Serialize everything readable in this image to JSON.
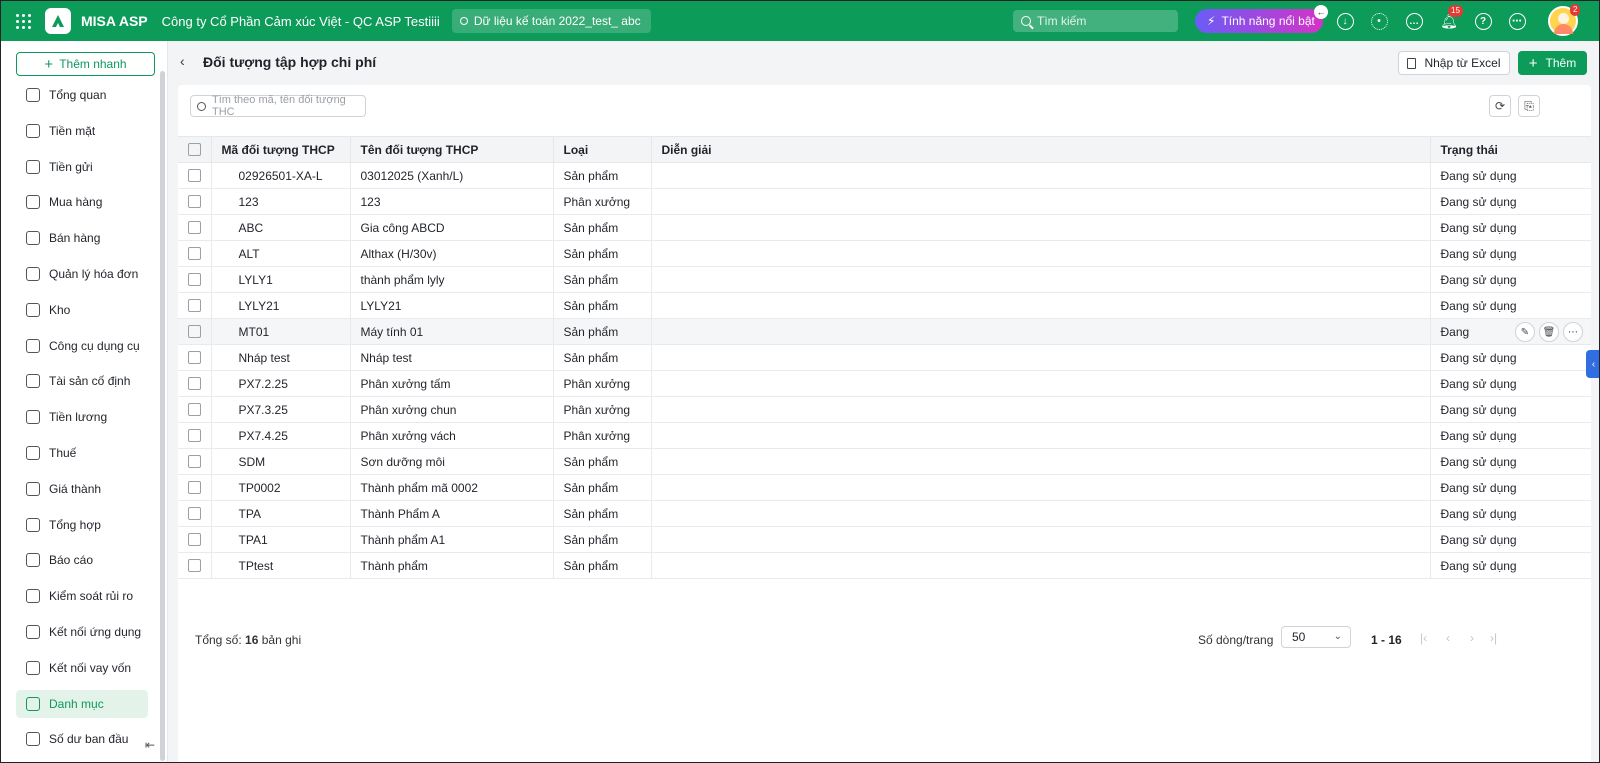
{
  "topbar": {
    "app_name": "MISA ASP",
    "company": "Công ty Cổ Phần Cảm xúc Việt - QC ASP Testiiii",
    "dataset": "Dữ liệu kế toán 2022_test_ abc",
    "search_placeholder": "Tìm kiếm",
    "feature_label": "Tính năng nổi bật",
    "notification_count": "15",
    "avatar_badge": "2"
  },
  "sidebar": {
    "quick_add": "Thêm nhanh",
    "items": [
      {
        "label": "Tổng quan",
        "icon": "dashboard-icon"
      },
      {
        "label": "Tiền mặt",
        "icon": "cash-icon"
      },
      {
        "label": "Tiền gửi",
        "icon": "bank-icon"
      },
      {
        "label": "Mua hàng",
        "icon": "shopping-bag-icon"
      },
      {
        "label": "Bán hàng",
        "icon": "cart-icon"
      },
      {
        "label": "Quản lý hóa đơn",
        "icon": "invoice-icon"
      },
      {
        "label": "Kho",
        "icon": "warehouse-icon"
      },
      {
        "label": "Công cụ dụng cụ",
        "icon": "tools-icon"
      },
      {
        "label": "Tài sản cố định",
        "icon": "truck-icon"
      },
      {
        "label": "Tiền lương",
        "icon": "salary-icon"
      },
      {
        "label": "Thuế",
        "icon": "tax-icon"
      },
      {
        "label": "Giá thành",
        "icon": "price-icon"
      },
      {
        "label": "Tổng hợp",
        "icon": "summary-icon"
      },
      {
        "label": "Báo cáo",
        "icon": "report-icon"
      },
      {
        "label": "Kiểm soát rủi ro",
        "icon": "risk-icon"
      },
      {
        "label": "Kết nối ứng dụng",
        "icon": "plug-icon"
      },
      {
        "label": "Kết nối vay vốn",
        "icon": "loan-icon"
      },
      {
        "label": "Danh mục",
        "icon": "list-icon"
      },
      {
        "label": "Số dư ban đầu",
        "icon": "balance-icon"
      }
    ],
    "active_index": 17
  },
  "page": {
    "title": "Đối tượng tập hợp chi phí",
    "import_excel": "Nhập từ Excel",
    "add": "Thêm",
    "search_placeholder": "Tìm theo mã, tên đối tượng THC"
  },
  "table": {
    "columns": [
      "Mã đối tượng THCP",
      "Tên đối tượng THCP",
      "Loại",
      "Diễn giải",
      "Trạng thái"
    ],
    "rows": [
      {
        "code": "02926501-XA-L",
        "name": "03012025 (Xanh/L)",
        "type": "Sản phẩm",
        "desc": "",
        "status": "Đang sử dụng"
      },
      {
        "code": "123",
        "name": "123",
        "type": "Phân xưởng",
        "desc": "",
        "status": "Đang sử dụng"
      },
      {
        "code": "ABC",
        "name": "Gia công ABCD",
        "type": "Sản phẩm",
        "desc": "",
        "status": "Đang sử dụng"
      },
      {
        "code": "ALT",
        "name": "Althax (H/30v)",
        "type": "Sản phẩm",
        "desc": "",
        "status": "Đang sử dụng"
      },
      {
        "code": "LYLY1",
        "name": "thành phẩm lyly",
        "type": "Sản phẩm",
        "desc": "",
        "status": "Đang sử dụng"
      },
      {
        "code": "LYLY21",
        "name": "LYLY21",
        "type": "Sản phẩm",
        "desc": "",
        "status": "Đang sử dụng"
      },
      {
        "code": "MT01",
        "name": "Máy tính 01",
        "type": "Sản phẩm",
        "desc": "",
        "status": "Đang"
      },
      {
        "code": "Nháp test",
        "name": "Nháp test",
        "type": "Sản phẩm",
        "desc": "",
        "status": "Đang sử dụng"
      },
      {
        "code": "PX7.2.25",
        "name": "Phân xưởng tấm",
        "type": "Phân xưởng",
        "desc": "",
        "status": "Đang sử dụng"
      },
      {
        "code": "PX7.3.25",
        "name": "Phân xưởng chun",
        "type": "Phân xưởng",
        "desc": "",
        "status": "Đang sử dụng"
      },
      {
        "code": "PX7.4.25",
        "name": "Phân xưởng vách",
        "type": "Phân xưởng",
        "desc": "",
        "status": "Đang sử dụng"
      },
      {
        "code": "SDM",
        "name": "Sơn dưỡng môi",
        "type": "Sản phẩm",
        "desc": "",
        "status": "Đang sử dụng"
      },
      {
        "code": "TP0002",
        "name": "Thành phẩm mã 0002",
        "type": "Sản phẩm",
        "desc": "",
        "status": "Đang sử dụng"
      },
      {
        "code": "TPA",
        "name": "Thành Phẩm A",
        "type": "Sản phẩm",
        "desc": "",
        "status": "Đang sử dụng"
      },
      {
        "code": "TPA1",
        "name": "Thành phẩm A1",
        "type": "Sản phẩm",
        "desc": "",
        "status": "Đang sử dụng"
      },
      {
        "code": "TPtest",
        "name": "Thành phẩm",
        "type": "Sản phẩm",
        "desc": "",
        "status": "Đang sử dụng"
      }
    ],
    "hovered_row": 6
  },
  "footer": {
    "total_prefix": "Tổng số:",
    "total_count": "16",
    "total_suffix": "bản ghi",
    "rows_per_page_label": "Số dòng/trang",
    "rows_per_page": "50",
    "range": "1 - 16"
  },
  "colors": {
    "brand": "#0d9b5a",
    "active_bg": "#e3f3ea"
  }
}
